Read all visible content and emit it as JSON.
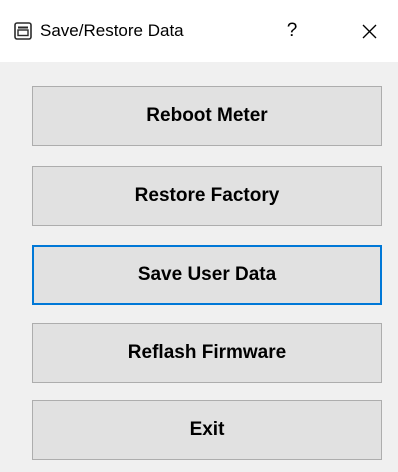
{
  "window": {
    "title": "Save/Restore Data",
    "icon": "window-app-icon",
    "help_label": "?"
  },
  "buttons": {
    "reboot_meter": "Reboot Meter",
    "restore_factory": "Restore Factory",
    "save_user_data": "Save User Data",
    "reflash_firmware": "Reflash Firmware",
    "exit": "Exit"
  },
  "focused_button": "save_user_data",
  "colors": {
    "background": "#f0f0f0",
    "titlebar": "#ffffff",
    "button_face": "#e1e1e1",
    "button_border": "#adadad",
    "focus_border": "#0078d7"
  }
}
